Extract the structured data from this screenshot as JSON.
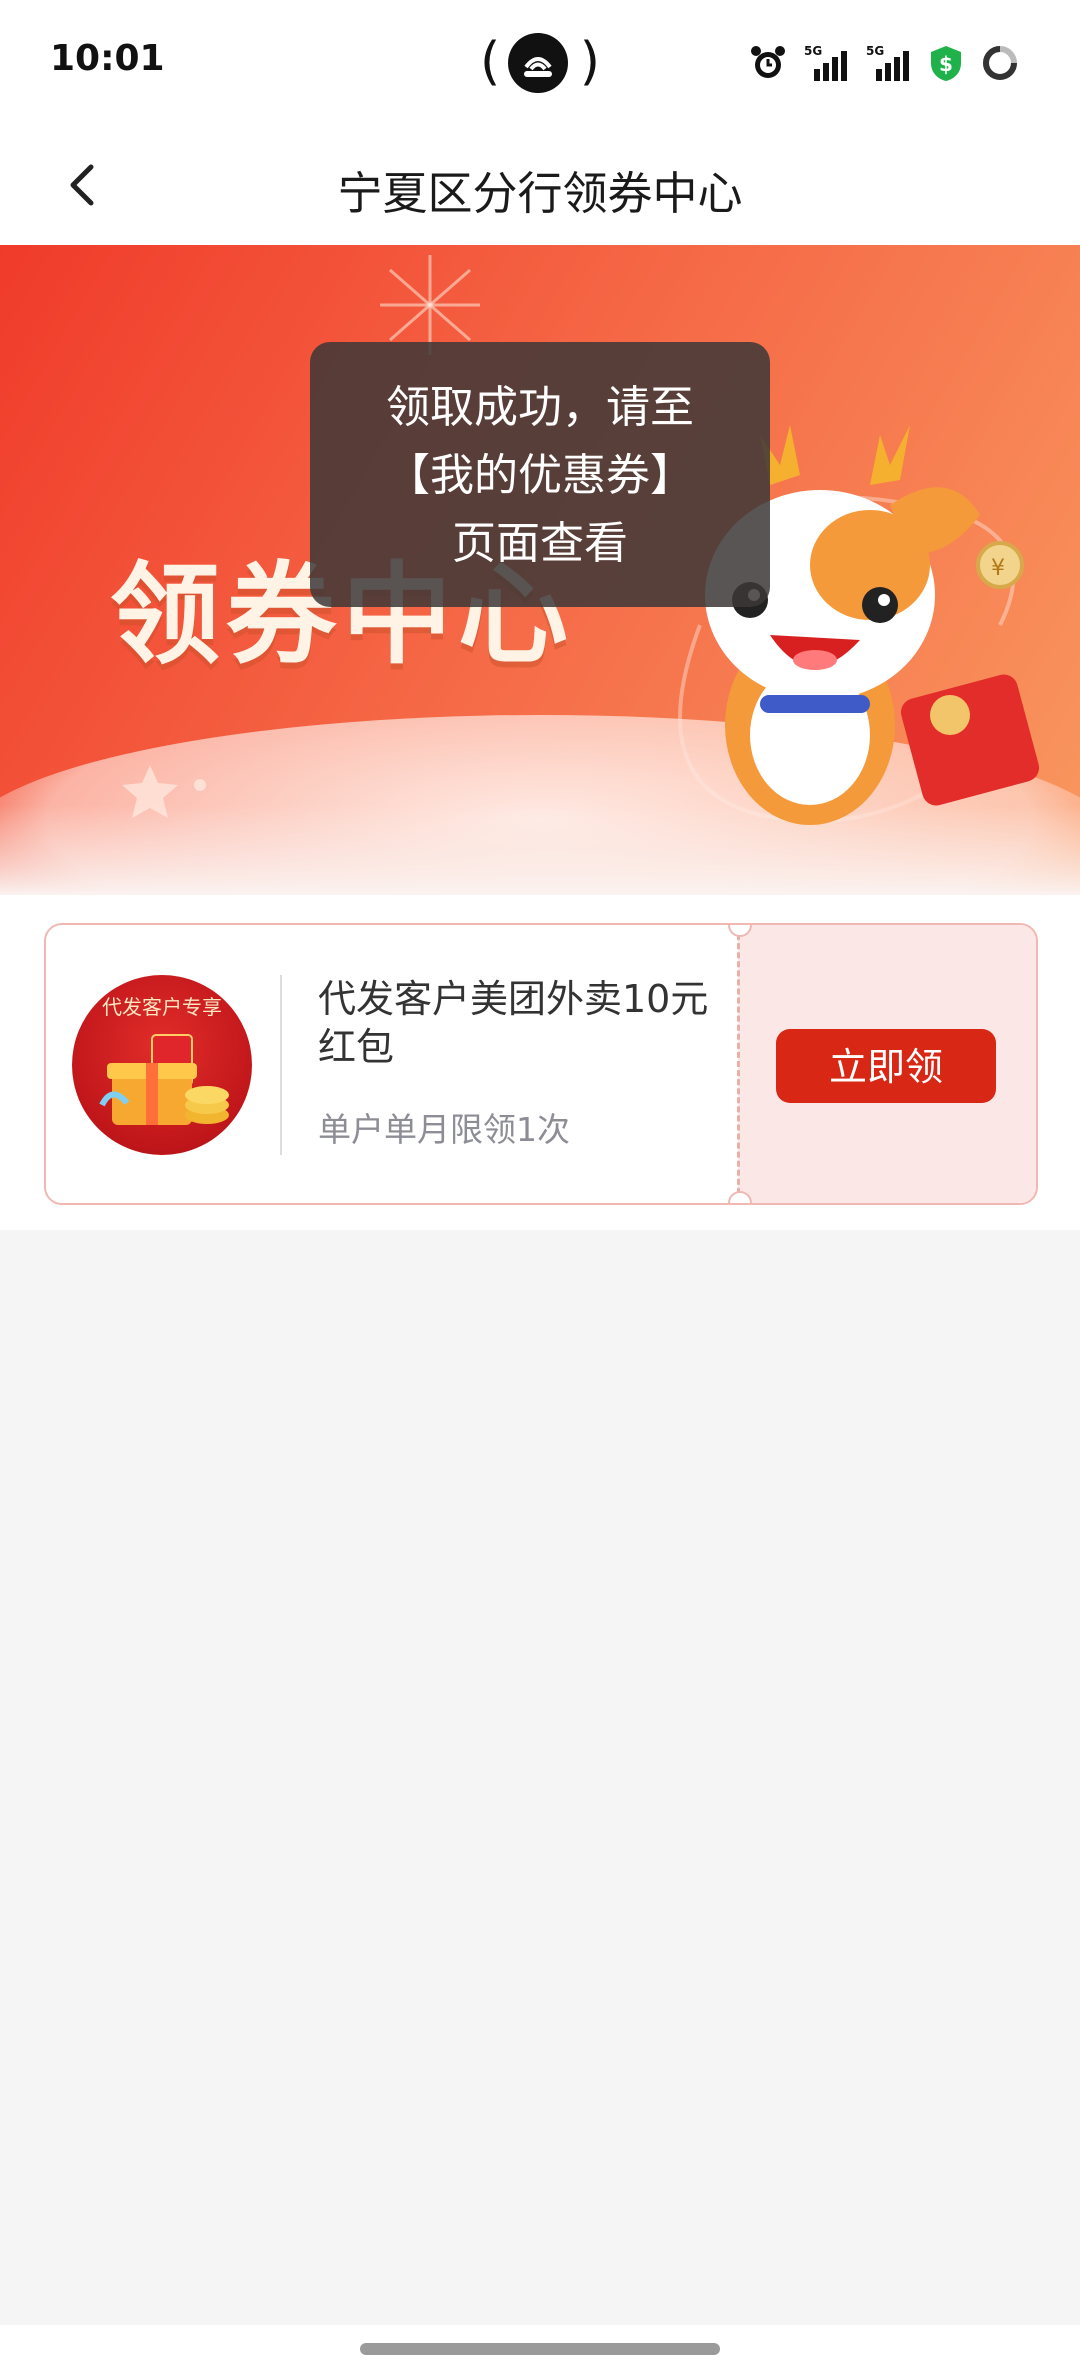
{
  "status_bar": {
    "time": "10:01",
    "icons": [
      "alarm-icon",
      "signal-5g-icon",
      "signal-5g-icon",
      "security-shield-icon",
      "loading-ring-icon"
    ]
  },
  "header": {
    "title": "宁夏区分行领券中心",
    "back_icon": "chevron-left-icon"
  },
  "banner": {
    "title": "领券中心"
  },
  "toast": {
    "line1": "领取成功，请至",
    "line2": "【我的优惠券】",
    "line3": "页面查看"
  },
  "coupons": [
    {
      "image_label": "代发客户专享",
      "title": "代发客户美团外卖10元红包",
      "limit": "单户单月限领1次",
      "button": "立即领"
    }
  ],
  "colors": {
    "accent_red": "#d92716",
    "banner_start": "#f03b2a",
    "banner_end": "#f9985f",
    "coupon_bg_right": "#fbe7e6"
  }
}
